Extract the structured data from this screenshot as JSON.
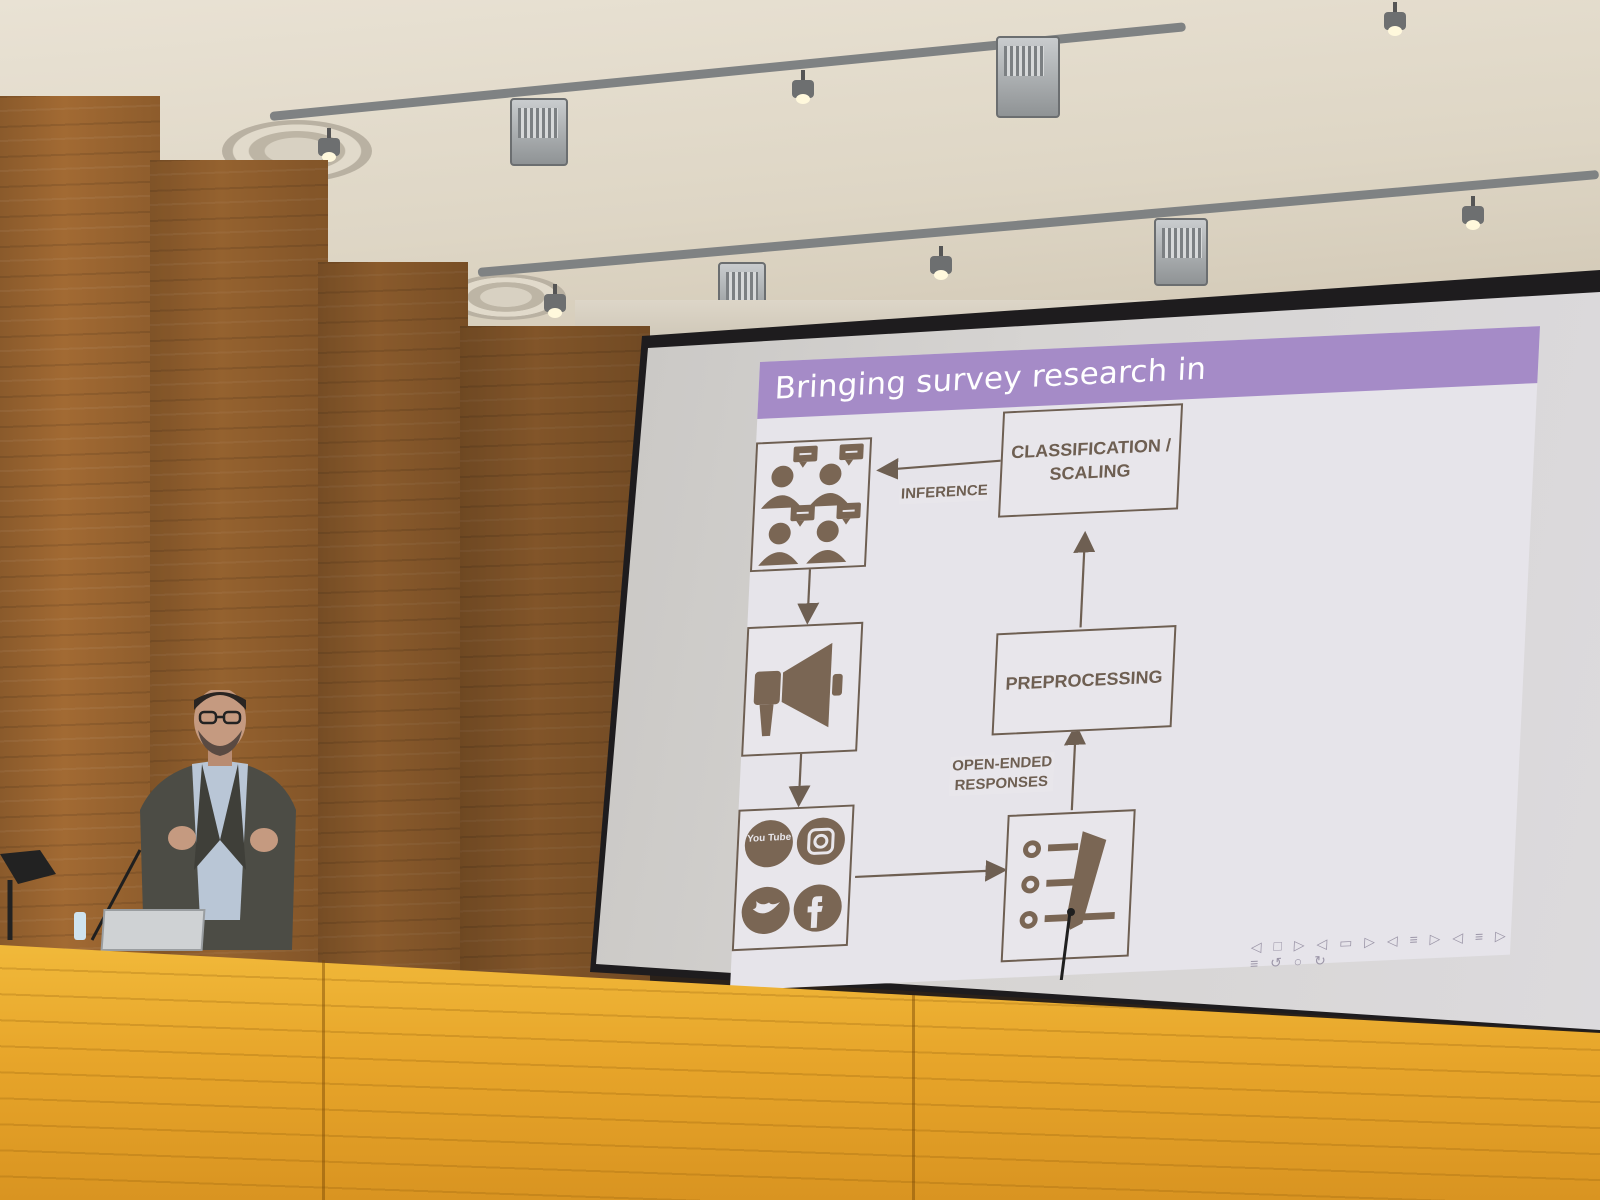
{
  "slide": {
    "title": "Bringing survey research in",
    "boxes": {
      "classification": "CLASSIFICATION / SCALING",
      "preprocessing": "PREPROCESSING"
    },
    "edge_labels": {
      "inference": "INFERENCE",
      "open_ended": "OPEN-ENDED RESPONSES"
    },
    "icons": [
      "audience-speech-icon",
      "megaphone-icon",
      "social-media-icons",
      "survey-checklist-icon"
    ],
    "social_icons": [
      "youtube-icon",
      "instagram-icon",
      "twitter-icon",
      "facebook-icon"
    ],
    "youtube_text": "You Tube",
    "header_color": "#a58bc7",
    "ink_color": "#6e5f52"
  },
  "scene": {
    "wall_color": "#9a6430",
    "desk_color": "#e9a82c",
    "ceiling_color": "#e3dccd"
  }
}
